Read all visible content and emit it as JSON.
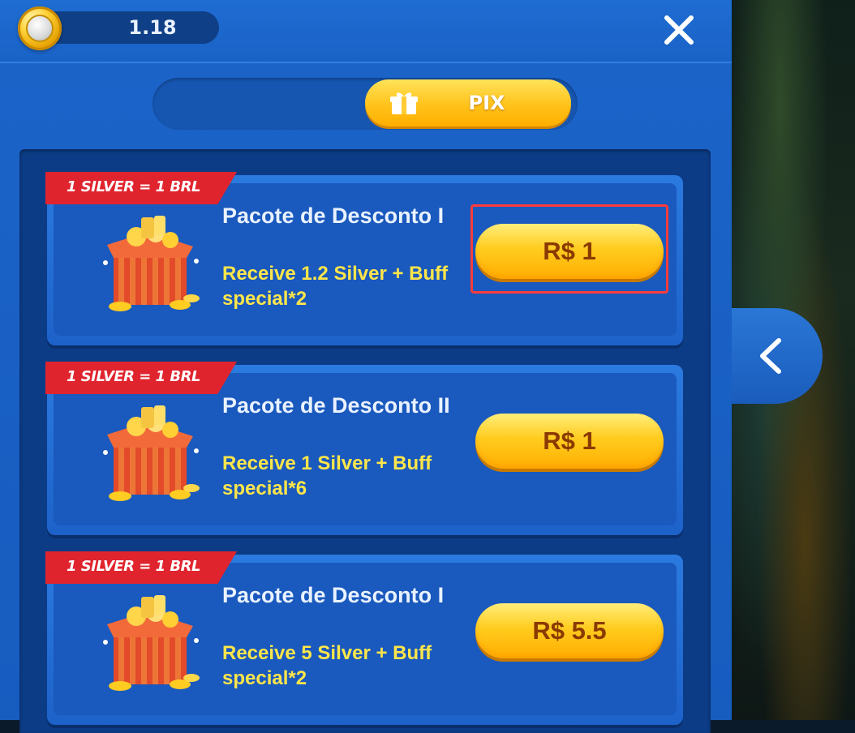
{
  "header": {
    "balance": "1.18",
    "coin_icon": "coin-icon",
    "close_icon": "close-icon"
  },
  "tabs": [
    {
      "label": "",
      "active": false
    },
    {
      "label": "PIX",
      "active": true,
      "icon": "gift-icon"
    }
  ],
  "packages": [
    {
      "ribbon": "1 SILVER = 1 BRL",
      "title": "Pacote de Desconto I",
      "description": "Receive 1.2 Silver + Buff special*2",
      "price": "R$ 1",
      "highlighted": true
    },
    {
      "ribbon": "1 SILVER = 1 BRL",
      "title": "Pacote de Desconto II",
      "description": "Receive 1 Silver + Buff special*6",
      "price": "R$ 1",
      "highlighted": false
    },
    {
      "ribbon": "1 SILVER = 1 BRL",
      "title": "Pacote de Desconto I",
      "description": "Receive 5 Silver + Buff special*2",
      "price": "R$ 5.5",
      "highlighted": false
    }
  ],
  "side": {
    "collapse_icon": "chevron-left-icon"
  },
  "colors": {
    "panel_blue": "#1c64c9",
    "button_gold": "#ffc21a",
    "ribbon_red": "#e0242e",
    "desc_yellow": "#ffe64a",
    "highlight_red": "#ff3b3b"
  }
}
